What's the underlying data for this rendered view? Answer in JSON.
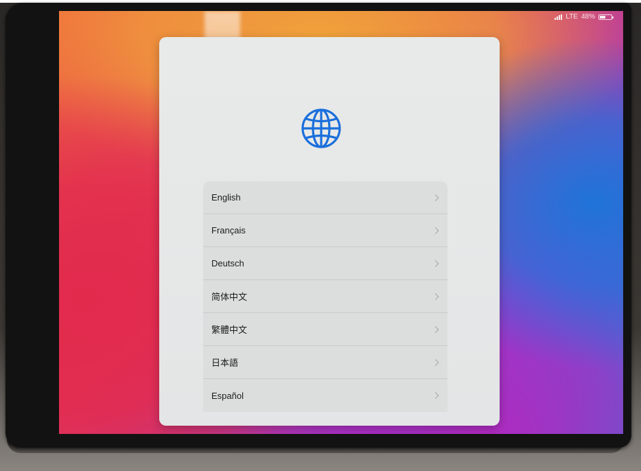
{
  "status_bar": {
    "network": "LTE",
    "battery": "48%"
  },
  "header": {
    "icon": "globe-icon"
  },
  "languages": [
    {
      "label": "English"
    },
    {
      "label": "Français"
    },
    {
      "label": "Deutsch"
    },
    {
      "label": "简体中文"
    },
    {
      "label": "繁體中文"
    },
    {
      "label": "日本語"
    },
    {
      "label": "Español"
    }
  ],
  "colors": {
    "accent": "#1a6fdc",
    "card": "#e6e7e7",
    "row": "#dcdedd",
    "chevron": "#a5a7a7"
  }
}
